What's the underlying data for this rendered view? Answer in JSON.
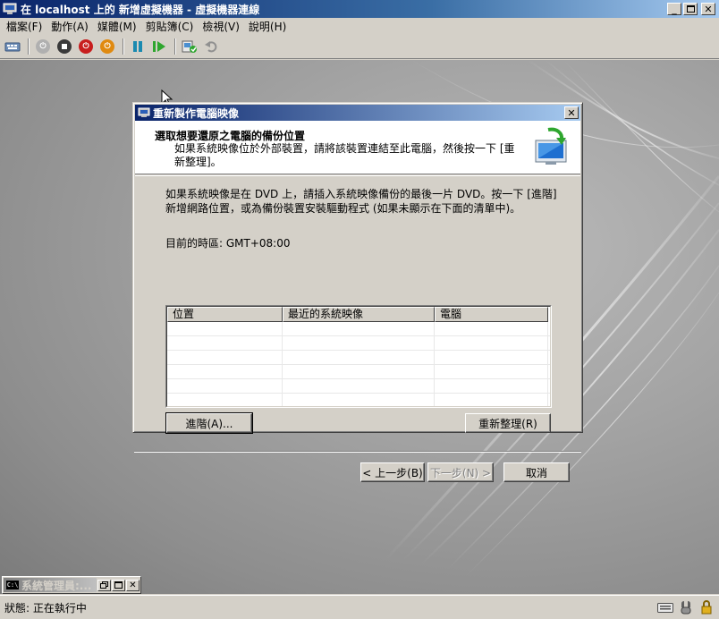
{
  "window": {
    "title": "在 localhost 上的 新增虛擬機器 - 虛擬機器連線"
  },
  "menu": [
    "檔案(F)",
    "動作(A)",
    "媒體(M)",
    "剪貼簿(C)",
    "檢視(V)",
    "說明(H)"
  ],
  "toolbar_icons": [
    "ctrl-alt-del-icon",
    "start-icon",
    "turn-off-icon",
    "shutdown-icon",
    "power-icon",
    "pause-icon",
    "resume-icon",
    "snapshot-icon",
    "revert-icon"
  ],
  "dialog": {
    "title": "重新製作電腦映像",
    "heading": "選取想要還原之電腦的備份位置",
    "subheading": "如果系統映像位於外部裝置，請將該裝置連結至此電腦，然後按一下 [重新整理]。",
    "intro": "如果系統映像是在 DVD 上，請插入系統映像備份的最後一片 DVD。按一下 [進階] 新增網路位置，或為備份裝置安裝驅動程式 (如果未顯示在下面的清單中)。",
    "timezone": "目前的時區: GMT+08:00",
    "columns": [
      "位置",
      "最近的系統映像",
      "電腦"
    ],
    "advanced_button": "進階(A)...",
    "refresh_button": "重新整理(R)",
    "back_button": "< 上一步(B)",
    "next_button": "下一步(N) >",
    "cancel_button": "取消"
  },
  "minimized_window": {
    "title": "系統管理員:..."
  },
  "status": {
    "text": "狀態: 正在執行中"
  }
}
